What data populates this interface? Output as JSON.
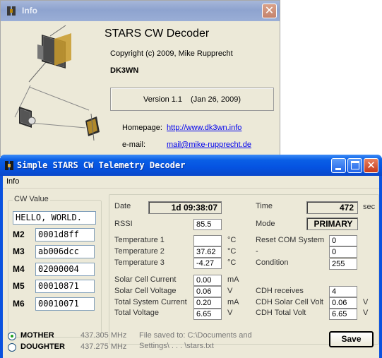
{
  "info_window": {
    "title": "Info",
    "app_title": "STARS CW Decoder",
    "copyright": "Copyright (c) 2009, Mike Rupprecht",
    "callsign": "DK3WN",
    "version": "Version 1.1",
    "version_date": "(Jan 26, 2009)",
    "homepage_label": "Homepage:",
    "homepage_url": "http://www.dk3wn.info",
    "email_label": "e-mail:",
    "email": "mail@mike-rupprecht.de"
  },
  "main_window": {
    "title": "Simple STARS CW Telemetry Decoder",
    "menu": [
      "Info"
    ]
  },
  "cw": {
    "legend": "CW Value",
    "text": "HELLO, WORLD.",
    "fields": [
      {
        "label": "M2",
        "value": "0001d8ff"
      },
      {
        "label": "M3",
        "value": "ab006dcc"
      },
      {
        "label": "M4",
        "value": "02000004"
      },
      {
        "label": "M5",
        "value": "00010871"
      },
      {
        "label": "M6",
        "value": "00010071"
      }
    ]
  },
  "telemetry": {
    "date_label": "Date",
    "date_value": "1d 09:38:07",
    "time_label": "Time",
    "time_value": "472",
    "time_unit": "sec",
    "rssi_label": "RSSI",
    "rssi_value": "85.5",
    "mode_label": "Mode",
    "mode_value": "PRIMARY",
    "left_rows": [
      {
        "label": "Temperature 1",
        "value": "",
        "unit": "°C"
      },
      {
        "label": "Temperature 2",
        "value": "37.62",
        "unit": "°C"
      },
      {
        "label": "Temperature 3",
        "value": "-4.27",
        "unit": "°C"
      },
      {
        "label": "Solar Cell Current",
        "value": "0.00",
        "unit": "mA"
      },
      {
        "label": "Solar Cell Voltage",
        "value": "0.06",
        "unit": "V"
      },
      {
        "label": "Total System Current",
        "value": "0.20",
        "unit": "mA"
      },
      {
        "label": "Total Voltage",
        "value": "6.65",
        "unit": "V"
      }
    ],
    "right_rows": [
      {
        "label": "Reset COM System",
        "value": "0",
        "unit": ""
      },
      {
        "label": "-",
        "value": "0",
        "unit": ""
      },
      {
        "label": "Condition",
        "value": "255",
        "unit": ""
      },
      {
        "label": "CDH receives",
        "value": "4",
        "unit": ""
      },
      {
        "label": "CDH Solar Cell Volt",
        "value": "0.06",
        "unit": "V"
      },
      {
        "label": "CDH Total Volt",
        "value": "6.65",
        "unit": "V"
      }
    ]
  },
  "satellites": [
    {
      "label": "MOTHER",
      "frequency": "437.305 MHz",
      "selected": true
    },
    {
      "label": "DOUGHTER",
      "frequency": "437.275 MHz",
      "selected": false
    }
  ],
  "file_saved": "File saved to: C:\\Documents and Settings\\ . . . \\stars.txt",
  "save_label": "Save",
  "colors": {
    "titlebar_active": "#0553e1",
    "titlebar_inactive": "#9aaed6",
    "window_face": "#ece9d8",
    "link": "#0000ee",
    "radio_dot": "#21a121"
  }
}
